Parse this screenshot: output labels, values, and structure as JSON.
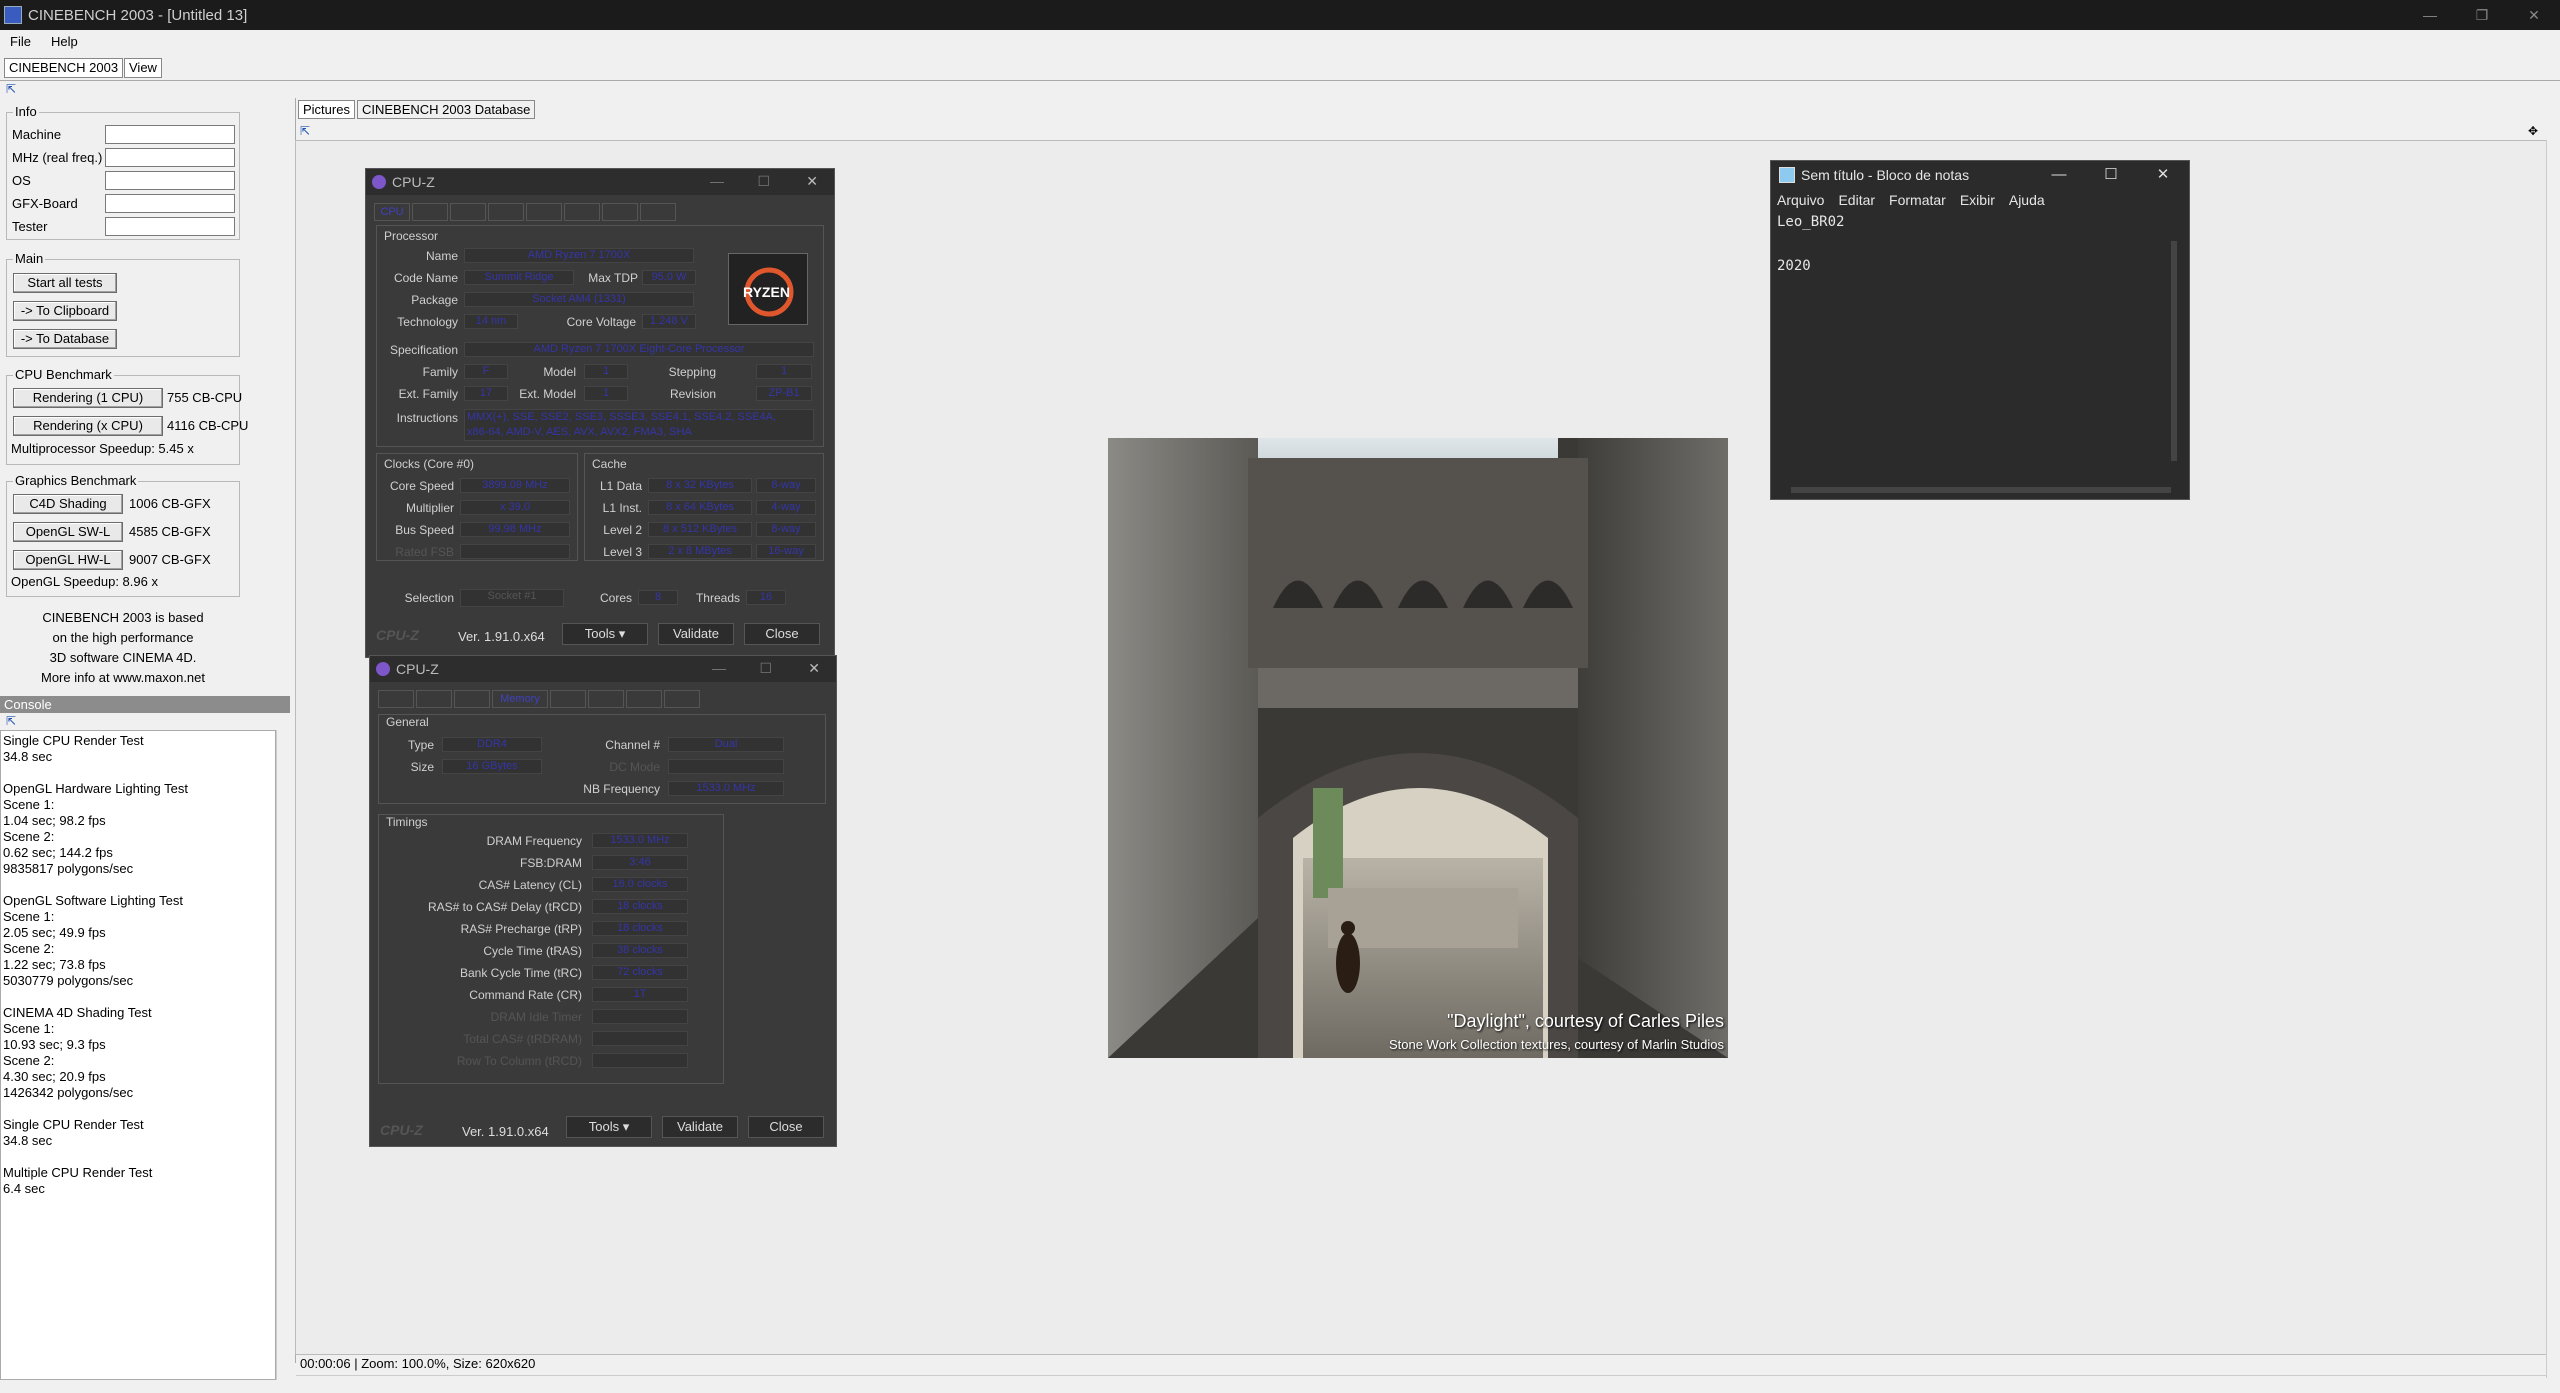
{
  "window": {
    "title": "CINEBENCH 2003 - [Untitled 13]",
    "controls": [
      "—",
      "❐",
      "✕"
    ]
  },
  "menubar": {
    "file": "File",
    "help": "Help"
  },
  "top_tabs": {
    "cinebench": "CINEBENCH 2003",
    "view": "View"
  },
  "info": {
    "title": "Info",
    "machine": "Machine",
    "mhz": "MHz (real freq.)",
    "os": "OS",
    "gfx": "GFX-Board",
    "tester": "Tester"
  },
  "main": {
    "title": "Main",
    "start_all": "Start all tests",
    "to_clipboard": "-> To Clipboard",
    "to_database": "-> To Database"
  },
  "cpu_benchmark": {
    "title": "CPU Benchmark",
    "rendering_1": "Rendering (1 CPU)",
    "rendering_1_val": "755 CB-CPU",
    "rendering_x": "Rendering (x CPU)",
    "rendering_x_val": "4116 CB-CPU",
    "speedup": "Multiprocessor Speedup: 5.45 x"
  },
  "graphics_benchmark": {
    "title": "Graphics Benchmark",
    "c4d": "C4D Shading",
    "c4d_val": "1006 CB-GFX",
    "sw": "OpenGL SW-L",
    "sw_val": "4585 CB-GFX",
    "hw": "OpenGL HW-L",
    "hw_val": "9007 CB-GFX",
    "speedup": "OpenGL Speedup: 8.96 x"
  },
  "about": {
    "l1": "CINEBENCH 2003 is based",
    "l2": "on the high performance",
    "l3": "3D software CINEMA 4D.",
    "l4": "More info at www.maxon.net"
  },
  "console": {
    "title": "Console",
    "text": "Single CPU Render Test\n34.8 sec\n\nOpenGL Hardware Lighting Test\nScene 1:\n1.04 sec; 98.2 fps\nScene 2:\n0.62 sec; 144.2 fps\n9835817 polygons/sec\n\nOpenGL Software Lighting Test\nScene 1:\n2.05 sec; 49.9 fps\nScene 2:\n1.22 sec; 73.8 fps\n5030779 polygons/sec\n\nCINEMA 4D Shading Test\nScene 1:\n10.93 sec; 9.3 fps\nScene 2:\n4.30 sec; 20.9 fps\n1426342 polygons/sec\n\nSingle CPU Render Test\n34.8 sec\n\nMultiple CPU Render Test\n6.4 sec"
  },
  "view_tabs": {
    "pictures": "Pictures",
    "database": "CINEBENCH 2003 Database"
  },
  "picture": {
    "caption1": "\"Daylight\", courtesy of Carles Piles",
    "caption2": "Stone Work Collection textures, courtesy of Marlin Studios"
  },
  "statusbar": {
    "text": "00:00:06 | Zoom: 100.0%, Size: 620x620"
  },
  "cpuz1": {
    "title": "CPU-Z",
    "tab_cpu": "CPU",
    "processor": "Processor",
    "name_l": "Name",
    "name_v": "AMD Ryzen 7 1700X",
    "code_l": "Code Name",
    "code_v": "Summit Ridge",
    "tdp_l": "Max TDP",
    "tdp_v": "95.0 W",
    "pkg_l": "Package",
    "pkg_v": "Socket AM4 (1331)",
    "tech_l": "Technology",
    "tech_v": "14 nm",
    "cv_l": "Core Voltage",
    "cv_v": "1.248 V",
    "spec_l": "Specification",
    "spec_v": "AMD Ryzen 7 1700X Eight-Core Processor",
    "fam_l": "Family",
    "fam_v": "F",
    "model_l": "Model",
    "model_v": "1",
    "step_l": "Stepping",
    "step_v": "1",
    "efam_l": "Ext. Family",
    "efam_v": "17",
    "emod_l": "Ext. Model",
    "emod_v": "1",
    "rev_l": "Revision",
    "rev_v": "ZP-B1",
    "ins_l": "Instructions",
    "ins_v1": "MMX(+), SSE, SSE2, SSE3, SSSE3, SSE4.1, SSE4.2, SSE4A,",
    "ins_v2": "x86-64, AMD-V, AES, AVX, AVX2, FMA3, SHA",
    "clocks": "Clocks (Core #0)",
    "cs_l": "Core Speed",
    "cs_v": "3899.09 MHz",
    "mult_l": "Multiplier",
    "mult_v": "x 39.0",
    "bus_l": "Bus Speed",
    "bus_v": "99.98 MHz",
    "fsb_l": "Rated FSB",
    "cache": "Cache",
    "l1d_l": "L1 Data",
    "l1d_v": "8 x 32 KBytes",
    "l1d_w": "8-way",
    "l1i_l": "L1 Inst.",
    "l1i_v": "8 x 64 KBytes",
    "l1i_w": "4-way",
    "l2_l": "Level 2",
    "l2_v": "8 x 512 KBytes",
    "l2_w": "8-way",
    "l3_l": "Level 3",
    "l3_v": "2 x 8 MBytes",
    "l3_w": "16-way",
    "sel_l": "Selection",
    "sel_v": "Socket #1",
    "cores_l": "Cores",
    "cores_v": "8",
    "thr_l": "Threads",
    "thr_v": "16",
    "ver": "Ver. 1.91.0.x64",
    "tools": "Tools",
    "validate": "Validate",
    "close": "Close",
    "logo_text": "RYZEN"
  },
  "cpuz2": {
    "title": "CPU-Z",
    "tab_mem": "Memory",
    "general": "General",
    "type_l": "Type",
    "type_v": "DDR4",
    "size_l": "Size",
    "size_v": "16 GBytes",
    "chan_l": "Channel #",
    "chan_v": "Dual",
    "dc_l": "DC Mode",
    "nb_l": "NB Frequency",
    "nb_v": "1533.0 MHz",
    "timings": "Timings",
    "dram_l": "DRAM Frequency",
    "dram_v": "1533.0 MHz",
    "fsb_l": "FSB:DRAM",
    "fsb_v": "3:46",
    "cl_l": "CAS# Latency (CL)",
    "cl_v": "16.0 clocks",
    "trcd_l": "RAS# to CAS# Delay (tRCD)",
    "trcd_v": "18 clocks",
    "trp_l": "RAS# Precharge (tRP)",
    "trp_v": "18 clocks",
    "tras_l": "Cycle Time (tRAS)",
    "tras_v": "38 clocks",
    "trc_l": "Bank Cycle Time (tRC)",
    "trc_v": "72 clocks",
    "cr_l": "Command Rate (CR)",
    "cr_v": "1T",
    "idle_l": "DRAM Idle Timer",
    "rdram_l": "Total CAS# (tRDRAM)",
    "rcd_l": "Row To Column (tRCD)",
    "ver": "Ver. 1.91.0.x64",
    "tools": "Tools",
    "validate": "Validate",
    "close": "Close"
  },
  "notepad": {
    "title": "Sem título - Bloco de notas",
    "m_arquivo": "Arquivo",
    "m_editar": "Editar",
    "m_formatar": "Formatar",
    "m_exibir": "Exibir",
    "m_ajuda": "Ajuda",
    "text": "Leo_BR02\n\n2020"
  }
}
